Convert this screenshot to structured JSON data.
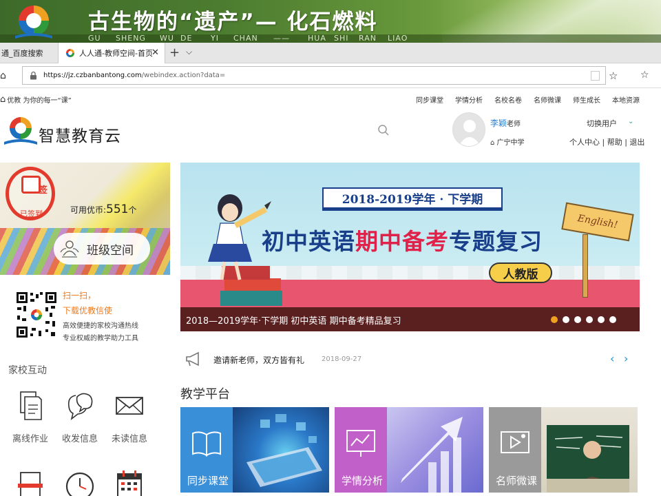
{
  "slide": {
    "title": "古生物的“遗产”— 化石燃料",
    "pinyin": [
      "GU",
      "SHENG",
      "WU",
      "DE",
      "YI",
      "CHAN",
      "——",
      "HUA",
      "SHI",
      "RAN",
      "LIAO"
    ]
  },
  "browser": {
    "tabs": [
      {
        "label": "通_百度搜索",
        "active": false
      },
      {
        "label": "人人通-教师空间-首页",
        "active": true
      }
    ],
    "new_tab": "+",
    "tab_menu": "⌵",
    "url_host": "https://jz.czbanbantong.com",
    "url_path": "/webindex.action?data="
  },
  "site": {
    "slogan": "优教 为你的每一“课”",
    "nav": [
      "同步课堂",
      "学情分析",
      "名校名卷",
      "名师微课",
      "师生成长",
      "本地资源"
    ],
    "brand": "智慧教育云",
    "user": {
      "name": "李颖",
      "role": "老师",
      "school": "广宁中学",
      "switch": "切换用户",
      "links": "个人中心 | 帮助 | 退出"
    }
  },
  "sidebar": {
    "signin_char": "签",
    "signin_status": "已签到",
    "coins_label": "可用优币:",
    "coins_value": "551",
    "coins_unit": "个",
    "class_space": "班级空间",
    "qr_title1": "扫一扫，",
    "qr_title2": "下载优教信使",
    "qr_desc1": "高效便捷的家校沟通热线",
    "qr_desc2": "专业权威的教学助力工具",
    "section_title": "家校互动",
    "apps": [
      {
        "label": "离线作业",
        "icon": "document-icon"
      },
      {
        "label": "收发信息",
        "icon": "chat-bubbles-icon"
      },
      {
        "label": "未读信息",
        "icon": "envelope-icon"
      }
    ]
  },
  "banner": {
    "semester": "2018-2019学年 · 下学期",
    "main_prefix": "初中英语",
    "main_highlight": "期中备考",
    "main_suffix": "专题复习",
    "edition": "人教版",
    "sign_text": "English!",
    "caption": "2018—2019学年·下学期 初中英语 期中备考精品复习",
    "slides_count": 6,
    "active_slide": 1
  },
  "notice": {
    "text": "邀请新老师，双方皆有礼",
    "date": "2018-09-27",
    "prev": "‹",
    "next": "›"
  },
  "platform": {
    "title": "教学平台",
    "cards": [
      {
        "label": "同步课堂",
        "color": "#3a8fd9"
      },
      {
        "label": "学情分析",
        "color": "#c060c8"
      },
      {
        "label": "名师微课",
        "color": "#9a9a9a"
      }
    ]
  },
  "colors": {
    "accent_blue": "#2b7fd0",
    "signin_red": "#e23a2c",
    "qr_orange": "#f07a1a",
    "dot_active": "#f0a020"
  }
}
